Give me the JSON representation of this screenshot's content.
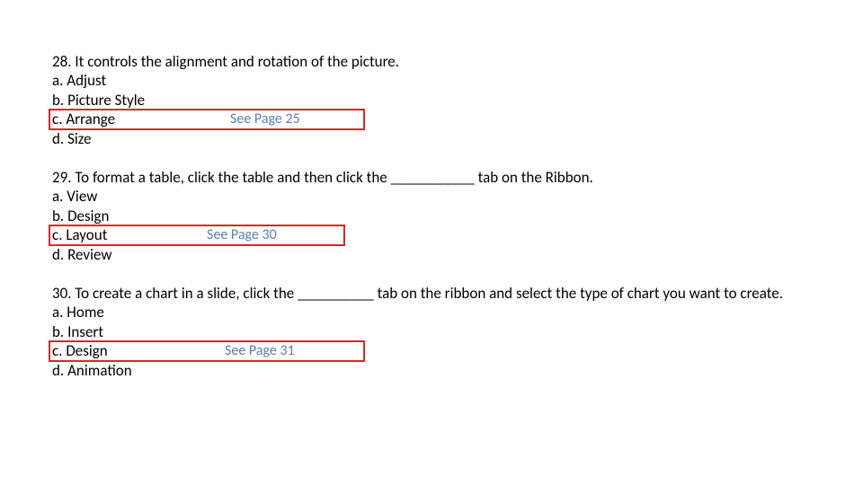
{
  "questions": [
    {
      "number": "28.",
      "text": "It controls the alignment and rotation of the picture.",
      "options": {
        "a": "Adjust",
        "b": "Picture Style",
        "c": "Arrange",
        "d": "Size"
      },
      "see_page": "See Page 25"
    },
    {
      "number": "29.",
      "text": "To format a table, click the table and then click the ___________ tab on the Ribbon.",
      "options": {
        "a": "View",
        "b": "Design",
        "c": "Layout",
        "d": "Review"
      },
      "see_page": "See Page 30"
    },
    {
      "number": "30.",
      "text": "To create a chart in a slide, click the __________ tab on the ribbon and select the type of chart you want to create.",
      "options": {
        "a": "Home",
        "b": "Insert",
        "c": "Design",
        "d": "Animation"
      },
      "see_page": "See Page 31"
    }
  ]
}
